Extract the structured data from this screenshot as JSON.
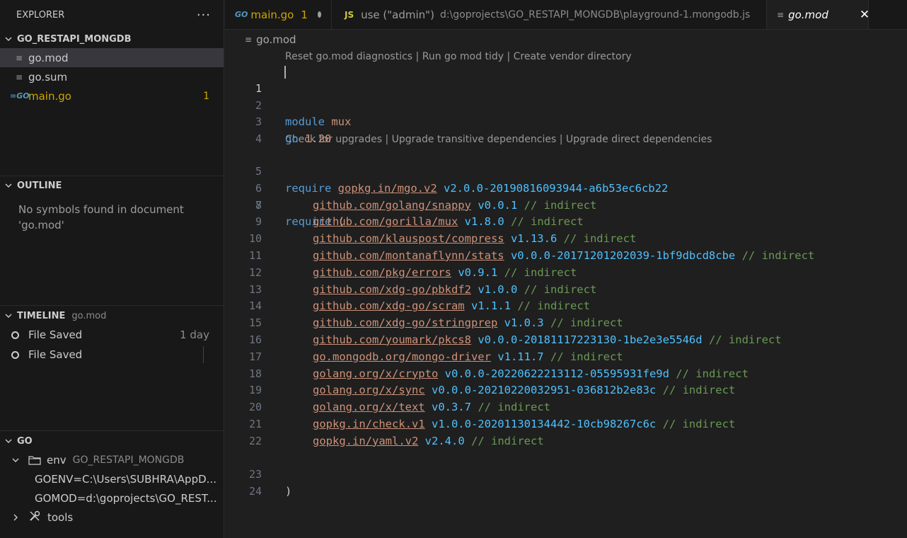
{
  "sidebar": {
    "explorer_title": "EXPLORER",
    "more_actions": "···",
    "project": {
      "name": "GO_RESTAPI_MONGDB",
      "files": [
        {
          "name": "go.mod",
          "icon": "file-lines-icon"
        },
        {
          "name": "go.sum",
          "icon": "file-lines-icon"
        },
        {
          "name": "main.go",
          "icon": "go-file-icon",
          "badge": "1"
        }
      ]
    },
    "outline": {
      "title": "OUTLINE",
      "message": "No symbols found in document 'go.mod'"
    },
    "timeline": {
      "title": "TIMELINE",
      "subtitle": "go.mod",
      "entries": [
        {
          "label": "File Saved",
          "when": "1 day"
        },
        {
          "label": "File Saved",
          "when": ""
        }
      ]
    },
    "go": {
      "title": "GO",
      "env_label": "env",
      "env_project": "GO_RESTAPI_MONGDB",
      "goenv": "GOENV=C:\\Users\\SUBHRA\\AppD...",
      "gomod": "GOMOD=d:\\goprojects\\GO_REST...",
      "tools_label": "tools"
    }
  },
  "tabs": [
    {
      "icon": "GO",
      "name": "main.go",
      "count": "1"
    },
    {
      "icon": "JS",
      "name": "use (\"admin\")",
      "desc": "d:\\goprojects\\GO_RESTAPI_MONGDB\\playground-1.mongodb.js"
    },
    {
      "icon": "≡",
      "name": "go.mod",
      "close": "✕"
    }
  ],
  "breadcrumb": {
    "icon": "≡",
    "file": "go.mod"
  },
  "codelens": {
    "top": "Reset go.mod diagnostics | Run go mod tidy | Create vendor directory",
    "require": "Check for upgrades | Upgrade transitive dependencies | Upgrade direct dependencies"
  },
  "code": {
    "module_kw": "module",
    "module_name": "mux",
    "go_kw": "go",
    "go_version": "1.20",
    "require_kw": "require",
    "direct_path": "gopkg.in/mgo.v2",
    "direct_version": "v2.0.0-20190816093944-a6b53ec6cb22",
    "open_paren": "(",
    "close_paren": ")",
    "indirect_comment": "// indirect",
    "deps": [
      {
        "path": "github.com/golang/snappy",
        "version": "v0.0.1"
      },
      {
        "path": "github.com/gorilla/mux",
        "version": "v1.8.0"
      },
      {
        "path": "github.com/klauspost/compress",
        "version": "v1.13.6"
      },
      {
        "path": "github.com/montanaflynn/stats",
        "version": "v0.0.0-20171201202039-1bf9dbcd8cbe"
      },
      {
        "path": "github.com/pkg/errors",
        "version": "v0.9.1"
      },
      {
        "path": "github.com/xdg-go/pbkdf2",
        "version": "v1.0.0"
      },
      {
        "path": "github.com/xdg-go/scram",
        "version": "v1.1.1"
      },
      {
        "path": "github.com/xdg-go/stringprep",
        "version": "v1.0.3"
      },
      {
        "path": "github.com/youmark/pkcs8",
        "version": "v0.0.0-20181117223130-1be2e3e5546d"
      },
      {
        "path": "go.mongodb.org/mongo-driver",
        "version": "v1.11.7"
      },
      {
        "path": "golang.org/x/crypto",
        "version": "v0.0.0-20220622213112-05595931fe9d"
      },
      {
        "path": "golang.org/x/sync",
        "version": "v0.0.0-20210220032951-036812b2e83c"
      },
      {
        "path": "golang.org/x/text",
        "version": "v0.3.7"
      },
      {
        "path": "gopkg.in/check.v1",
        "version": "v1.0.0-20201130134442-10cb98267c6c"
      },
      {
        "path": "gopkg.in/yaml.v2",
        "version": "v2.4.0"
      }
    ],
    "line_numbers": [
      "1",
      "2",
      "3",
      "4",
      "5",
      "6",
      "7",
      "8",
      "9",
      "10",
      "11",
      "12",
      "13",
      "14",
      "15",
      "16",
      "17",
      "18",
      "19",
      "20",
      "21",
      "22",
      "23",
      "24"
    ]
  },
  "colors": {
    "keyword": "#569cd6",
    "string": "#ce9178",
    "version": "#4fc1ff",
    "comment": "#6a9955",
    "modified": "#cca700"
  }
}
